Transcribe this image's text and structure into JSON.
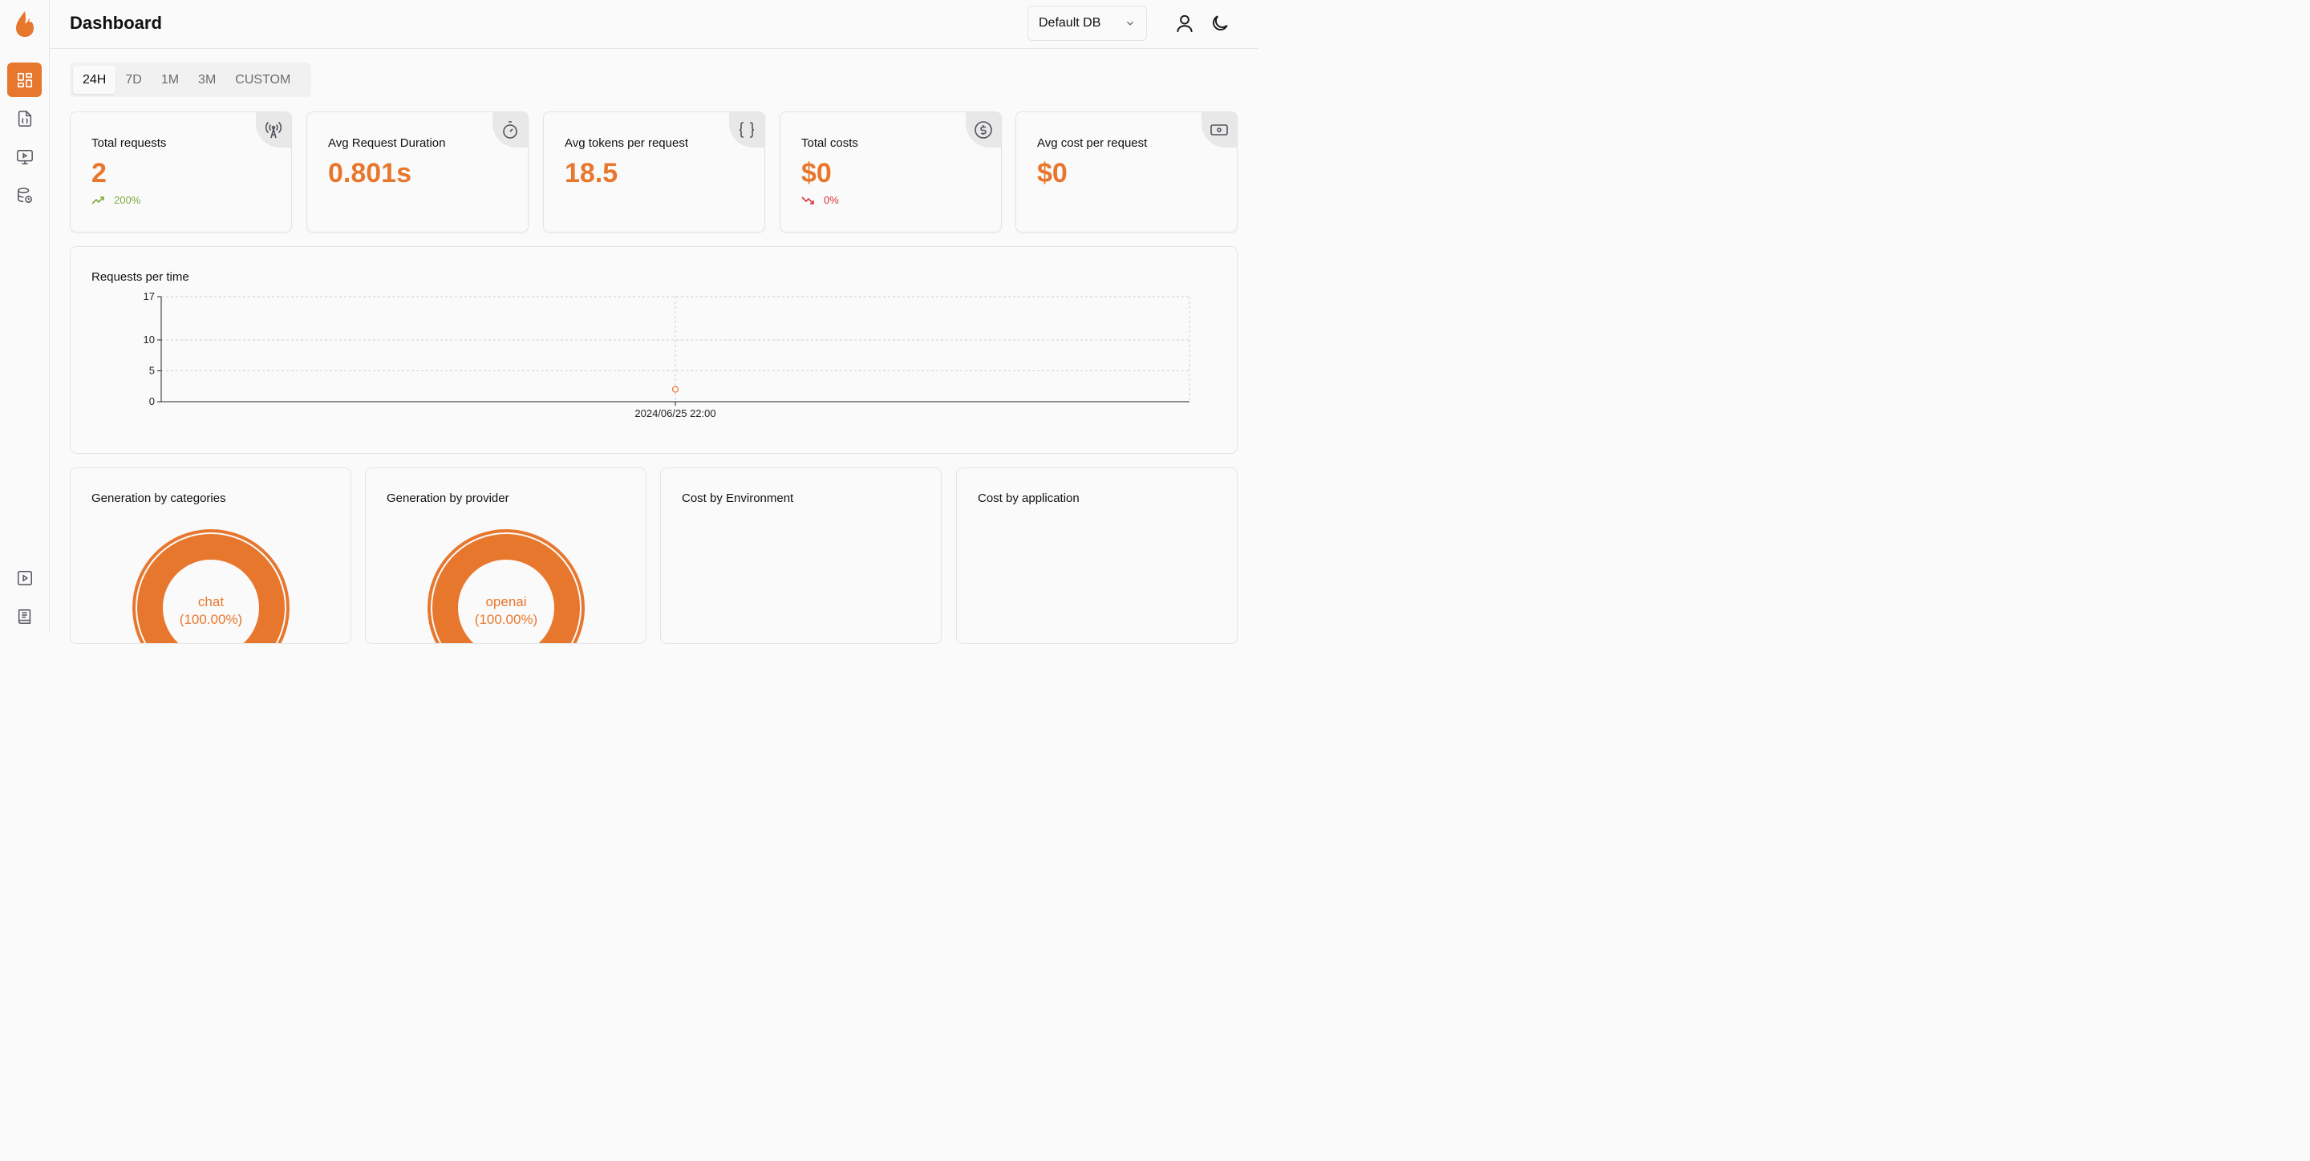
{
  "app": {
    "accent": "#e8772e"
  },
  "header": {
    "title": "Dashboard",
    "db_select": "Default DB"
  },
  "sidebar": {
    "items": [
      {
        "name": "dashboard-icon",
        "active": true
      },
      {
        "name": "requests-icon"
      },
      {
        "name": "monitor-play-icon"
      },
      {
        "name": "database-history-icon"
      },
      {
        "name": "play-icon"
      },
      {
        "name": "book-icon"
      }
    ]
  },
  "time_tabs": [
    "24H",
    "7D",
    "1M",
    "3M",
    "CUSTOM"
  ],
  "active_tab": "24H",
  "stats": [
    {
      "label": "Total requests",
      "value": "2",
      "delta": "200%",
      "delta_dir": "up",
      "icon": "antenna-icon"
    },
    {
      "label": "Avg Request Duration",
      "value": "0.801s",
      "icon": "timer-icon"
    },
    {
      "label": "Avg tokens per request",
      "value": "18.5",
      "icon": "braces-icon"
    },
    {
      "label": "Total costs",
      "value": "$0",
      "delta": "0%",
      "delta_dir": "down",
      "icon": "dollar-circle-icon"
    },
    {
      "label": "Avg cost per request",
      "value": "$0",
      "icon": "banknote-icon"
    }
  ],
  "requests_chart": {
    "title": "Requests per time",
    "chart_data": {
      "type": "scatter",
      "x": [
        "2024/06/25 22:00"
      ],
      "y": [
        2
      ],
      "ylim": [
        0,
        17
      ],
      "yticks": [
        0,
        5,
        10,
        17
      ],
      "grid": true
    }
  },
  "bottom_cards": [
    {
      "title": "Generation by categories",
      "donut_label": "chat",
      "donut_pct": "(100.00%)"
    },
    {
      "title": "Generation by provider",
      "donut_label": "openai",
      "donut_pct": "(100.00%)"
    },
    {
      "title": "Cost by Environment"
    },
    {
      "title": "Cost by application"
    }
  ],
  "chart_data": {
    "type": "scatter",
    "x": [
      "2024/06/25 22:00"
    ],
    "y": [
      2
    ],
    "ylim": [
      0,
      17
    ],
    "yticks": [
      0,
      5,
      10,
      17
    ],
    "title": "Requests per time"
  }
}
